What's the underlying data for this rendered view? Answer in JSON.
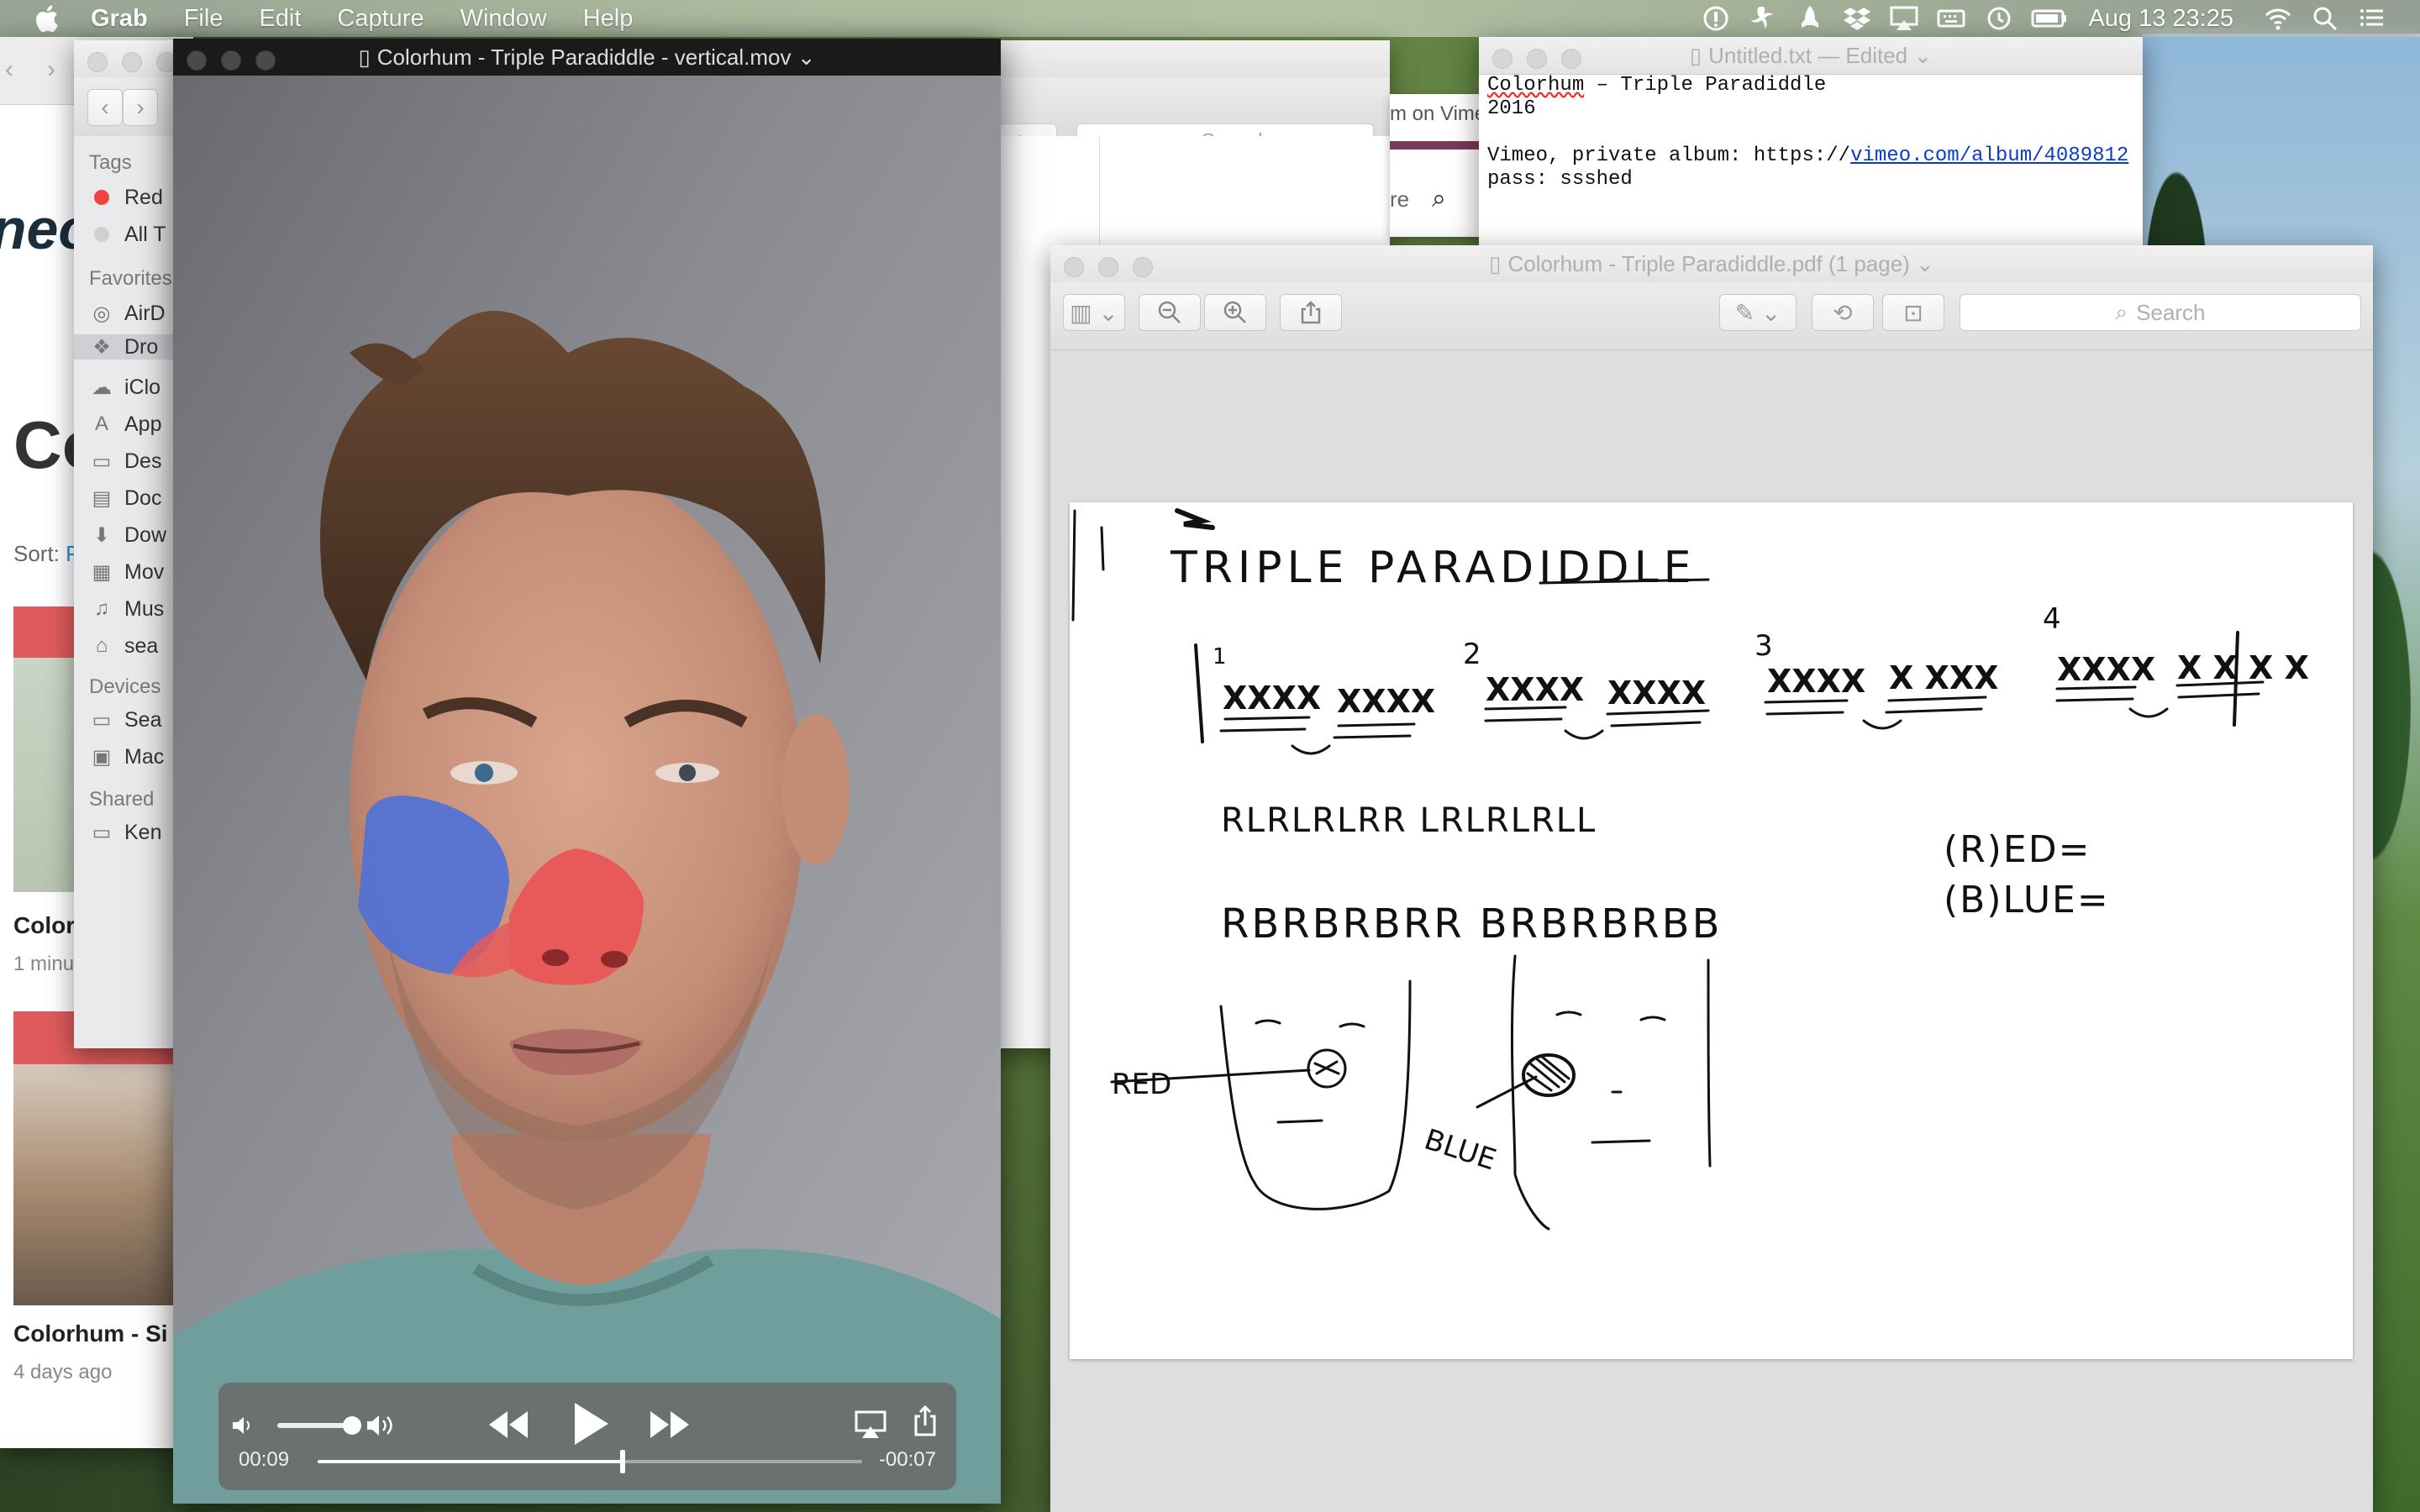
{
  "menubar": {
    "app_name": "Grab",
    "items": [
      "File",
      "Edit",
      "Capture",
      "Window",
      "Help"
    ],
    "clock": "Aug 13  23:25",
    "status_icons": [
      "accessibility-icon",
      "fan-icon",
      "dropbox-icon",
      "airplay-icon",
      "keyboard-icon",
      "time-machine-icon",
      "battery-icon",
      "wifi-icon",
      "spotlight-icon",
      "notification-center-icon"
    ]
  },
  "browser": {
    "logo": "neo",
    "big_heading": "Co",
    "sort_label": "Sort:",
    "sort_value": "P",
    "video1_title": "Color",
    "video1_age": "1 minu",
    "video2_title": "Colorhum - Si",
    "video2_age": "4 days ago"
  },
  "finder": {
    "sections": {
      "tags": "Tags",
      "favorites": "Favorites",
      "devices": "Devices",
      "shared": "Shared"
    },
    "tags": [
      {
        "label": "Red",
        "color": "#ee4444"
      },
      {
        "label": "All T",
        "color": "#d0d0d0"
      }
    ],
    "favorites": [
      "AirD",
      "Dro",
      "iClo",
      "App",
      "Des",
      "Doc",
      "Dow",
      "Mov",
      "Mus",
      "sea"
    ],
    "devices": [
      "Sea",
      "Mac"
    ],
    "shared": [
      "Ken"
    ],
    "search_placeholder": "Search",
    "partial_label": "lorhun"
  },
  "vimeo_strip": {
    "tab_text": "m on Vime",
    "partial": "re"
  },
  "textedit": {
    "title": "Untitled.txt",
    "status": " — Edited",
    "line1_a": "Colorhum",
    "line1_b": " – Triple Paradiddle",
    "line2": "2016",
    "line3_a": "Vimeo, private album: https://",
    "line3_link": "vimeo.com/album/4089812",
    "line4": "pass: ssshed"
  },
  "preview": {
    "title": "Colorhum - Triple Paradiddle.pdf (1 page)",
    "search_placeholder": "Search",
    "sheet": {
      "heading": "TRIPLE  PARADIDDLE",
      "measure_numbers": [
        "1",
        "2",
        "3",
        "4"
      ],
      "x_groups": [
        "XXXX",
        "XXXX",
        "XXXX",
        "XXXX",
        "XXXX",
        "X XXX",
        "XXXX",
        "X X X X"
      ],
      "sticking_lr": "RLRLRLRR  LRLRLRLL",
      "sticking_br": "RBRBRBRR  BRBRBRBB",
      "legend_red": "(R)ED=",
      "legend_blue": "(B)LUE=",
      "label_red": "RED",
      "label_blue": "BLUE"
    }
  },
  "quicktime": {
    "title": "Colorhum - Triple Paradiddle - vertical.mov",
    "elapsed": "00:09",
    "remaining": "-00:07",
    "progress": 0.56,
    "volume": 0.85
  }
}
